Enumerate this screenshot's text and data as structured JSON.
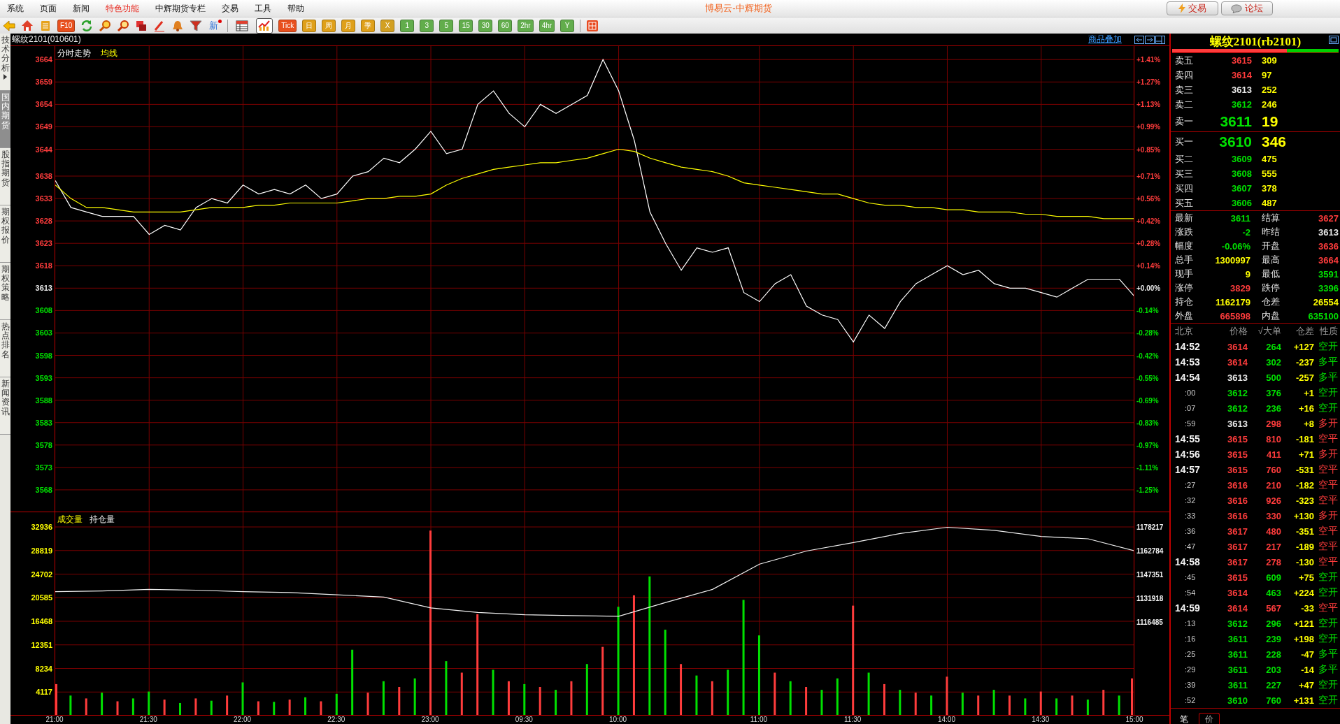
{
  "menu": [
    {
      "label": "系统",
      "highlight": false
    },
    {
      "label": "页面",
      "highlight": false
    },
    {
      "label": "新闻",
      "highlight": false
    },
    {
      "label": "特色功能",
      "highlight": true
    },
    {
      "label": "中辉期货专栏",
      "highlight": false
    },
    {
      "label": "交易",
      "highlight": false
    },
    {
      "label": "工具",
      "highlight": false
    },
    {
      "label": "帮助",
      "highlight": false
    }
  ],
  "window": {
    "title": "博易云-中辉期货"
  },
  "top_buttons": [
    {
      "label": "交易",
      "kind": "trade"
    },
    {
      "label": "论坛",
      "kind": "forum"
    }
  ],
  "toolbar": {
    "f10": "F10",
    "news": "新",
    "views": [
      {
        "selected": false
      },
      {
        "selected": true
      }
    ],
    "periods": [
      {
        "label": "Tick",
        "color": "#e8501e"
      },
      {
        "label": "日",
        "color": "#dfa01a"
      },
      {
        "label": "周",
        "color": "#dfa01a"
      },
      {
        "label": "月",
        "color": "#dfa01a"
      },
      {
        "label": "季",
        "color": "#dfa01a"
      },
      {
        "label": "X",
        "color": "#d2a022"
      },
      {
        "label": "1",
        "color": "#62ad4c"
      },
      {
        "label": "3",
        "color": "#62ad4c"
      },
      {
        "label": "5",
        "color": "#62ad4c"
      },
      {
        "label": "15",
        "color": "#62ad4c"
      },
      {
        "label": "30",
        "color": "#62ad4c"
      },
      {
        "label": "60",
        "color": "#62ad4c"
      },
      {
        "label": "2hr",
        "color": "#62ad4c"
      },
      {
        "label": "4hr",
        "color": "#62ad4c"
      },
      {
        "label": "Y",
        "color": "#62ad4c"
      }
    ]
  },
  "side_tabs": [
    {
      "label": "技术分析",
      "selected": false,
      "has_arrow": true
    },
    {
      "label": "国内期货",
      "selected": true,
      "has_arrow": false
    },
    {
      "label": "股指期货",
      "selected": false,
      "has_arrow": false
    },
    {
      "label": "期权报价",
      "selected": false,
      "has_arrow": false
    },
    {
      "label": "期权策略",
      "selected": false,
      "has_arrow": false
    },
    {
      "label": "热点排名",
      "selected": false,
      "has_arrow": false
    },
    {
      "label": "新闻资讯",
      "selected": false,
      "has_arrow": false
    }
  ],
  "chart_header": {
    "title": "螺纹2101(010601)",
    "overlay_link": "商品叠加"
  },
  "price_chart": {
    "percent_ticks": [
      {
        "label": "+1.41%",
        "color": "#ff3c3c"
      },
      {
        "label": "+1.27%",
        "color": "#ff3c3c"
      },
      {
        "label": "+1.13%",
        "color": "#ff3c3c"
      },
      {
        "label": "+0.99%",
        "color": "#ff3c3c"
      },
      {
        "label": "+0.85%",
        "color": "#ff3c3c"
      },
      {
        "label": "+0.71%",
        "color": "#ff3c3c"
      },
      {
        "label": "+0.56%",
        "color": "#ff3c3c"
      },
      {
        "label": "+0.42%",
        "color": "#ff3c3c"
      },
      {
        "label": "+0.28%",
        "color": "#ff3c3c"
      },
      {
        "label": "+0.14%",
        "color": "#ff3c3c"
      },
      {
        "label": "+0.00%",
        "color": "#e8e8e8"
      },
      {
        "label": "-0.14%",
        "color": "#00e000"
      },
      {
        "label": "-0.28%",
        "color": "#00e000"
      },
      {
        "label": "-0.42%",
        "color": "#00e000"
      },
      {
        "label": "-0.55%",
        "color": "#00e000"
      },
      {
        "label": "-0.69%",
        "color": "#00e000"
      },
      {
        "label": "-0.83%",
        "color": "#00e000"
      },
      {
        "label": "-0.97%",
        "color": "#00e000"
      },
      {
        "label": "-1.11%",
        "color": "#00e000"
      },
      {
        "label": "-1.25%",
        "color": "#00e000"
      }
    ],
    "chart_data": {
      "type": "line",
      "grid": true,
      "categories": [
        null,
        null,
        null,
        null,
        null,
        null,
        null,
        null,
        null,
        null,
        null,
        null,
        null,
        null,
        null,
        null,
        null,
        null,
        null,
        null,
        null,
        null,
        null,
        null,
        null,
        null,
        null,
        null,
        null,
        null,
        null,
        null,
        null,
        null,
        null,
        null,
        null,
        null,
        null,
        null,
        null,
        null,
        null,
        null,
        null,
        null,
        null,
        null,
        null,
        null,
        null,
        null,
        null,
        null,
        null,
        null,
        null,
        null,
        null,
        null,
        null,
        null,
        null,
        null,
        null,
        null,
        null,
        null,
        null,
        null
      ],
      "series": [
        {
          "name": "分时走势",
          "color": "#ffffff",
          "values": [
            3637,
            3631,
            3630,
            3629,
            3629,
            3629,
            3625,
            3627,
            3626,
            3631,
            3633,
            3632,
            3636,
            3634,
            3635,
            3634,
            3636,
            3633,
            3634,
            3638,
            3639,
            3642,
            3641,
            3644,
            3648,
            3643,
            3644,
            3654,
            3657,
            3652,
            3649,
            3654,
            3652,
            3654,
            3656,
            3664,
            3657,
            3646,
            3630,
            3623,
            3617,
            3622,
            3621,
            3622,
            3612,
            3610,
            3614,
            3616,
            3609,
            3607,
            3606,
            3601,
            3607,
            3604,
            3610,
            3614,
            3616,
            3618,
            3616,
            3617,
            3614,
            3613,
            3613,
            3612,
            3611,
            3613,
            3615,
            3615,
            3615,
            3611
          ]
        },
        {
          "name": "均线",
          "color": "#ffff00",
          "values": [
            3636,
            3633,
            3631,
            3631,
            3630.5,
            3630,
            3630,
            3630,
            3630,
            3630.5,
            3631,
            3631,
            3631,
            3631.5,
            3631.5,
            3632,
            3632,
            3632,
            3632,
            3632.5,
            3633,
            3633,
            3633.5,
            3633.5,
            3634,
            3636,
            3637.5,
            3638.5,
            3639.5,
            3640,
            3640.5,
            3641,
            3641,
            3641.5,
            3642,
            3643,
            3644,
            3643.5,
            3642,
            3641,
            3640,
            3639.5,
            3639,
            3638,
            3636.5,
            3636,
            3635.5,
            3635,
            3634.5,
            3634,
            3634,
            3633,
            3632,
            3631.5,
            3631.5,
            3631,
            3631,
            3630.5,
            3630.5,
            3630,
            3630,
            3630,
            3629.5,
            3629.5,
            3629,
            3629,
            3629,
            3628.5,
            3628.5,
            3628.5
          ]
        }
      ],
      "ylim": [
        3563,
        3667
      ],
      "yticks": [
        {
          "value": 3664,
          "label": "3664"
        },
        {
          "value": 3659,
          "label": "3659"
        },
        {
          "value": 3654,
          "label": "3654"
        },
        {
          "value": 3649,
          "label": "3649"
        },
        {
          "value": 3644,
          "label": "3644"
        },
        {
          "value": 3638,
          "label": "3638"
        },
        {
          "value": 3633,
          "label": "3633"
        },
        {
          "value": 3628,
          "label": "3628"
        },
        {
          "value": 3623,
          "label": "3623"
        },
        {
          "value": 3618,
          "label": "3618"
        },
        {
          "value": 3613,
          "label": "3613"
        },
        {
          "value": 3608,
          "label": "3608"
        },
        {
          "value": 3603,
          "label": "3603"
        },
        {
          "value": 3598,
          "label": "3598"
        },
        {
          "value": 3593,
          "label": "3593"
        },
        {
          "value": 3588,
          "label": "3588"
        },
        {
          "value": 3583,
          "label": "3583"
        },
        {
          "value": 3578,
          "label": "3578"
        },
        {
          "value": 3573,
          "label": "3573"
        },
        {
          "value": 3568,
          "label": "3568"
        }
      ]
    }
  },
  "volume_panel": {
    "volume": {
      "chart_data": {
        "type": "bar",
        "title": "成交量",
        "grid": true,
        "categories": [
          "21:00",
          null,
          null,
          null,
          null,
          null,
          "21:30",
          null,
          null,
          null,
          null,
          null,
          "22:00",
          null,
          null,
          null,
          null,
          null,
          "22:30",
          null,
          null,
          null,
          null,
          null,
          "23:00",
          null,
          null,
          null,
          null,
          null,
          "09:30",
          null,
          null,
          null,
          null,
          null,
          "10:00",
          null,
          null,
          null,
          null,
          null,
          null,
          null,
          null,
          "11:00",
          null,
          null,
          null,
          null,
          null,
          "11:30",
          null,
          null,
          null,
          null,
          null,
          "14:00",
          null,
          null,
          null,
          null,
          null,
          "14:30",
          null,
          null,
          null,
          null,
          null,
          "15:00"
        ],
        "series": [
          {
            "color": "#ff3c3c",
            "values": [
              5500,
              null,
              3000,
              null,
              2500,
              null,
              null,
              2800,
              null,
              3000,
              null,
              3500,
              null,
              2500,
              null,
              2800,
              null,
              2500,
              null,
              null,
              4000,
              null,
              5000,
              null,
              32300,
              null,
              7500,
              17700,
              null,
              6000,
              null,
              5000,
              null,
              6000,
              null,
              12000,
              null,
              21000,
              null,
              null,
              9000,
              null,
              6000,
              null,
              null,
              null,
              7500,
              null,
              5000,
              null,
              null,
              19200,
              null,
              5500,
              null,
              4000,
              null,
              6800,
              null,
              3500,
              null,
              3500,
              null,
              4200,
              null,
              3500,
              null,
              4500,
              null,
              6500
            ]
          },
          {
            "color": "#00e000",
            "values": [
              null,
              3500,
              null,
              4000,
              null,
              3000,
              4200,
              null,
              2200,
              null,
              2600,
              null,
              5800,
              null,
              2400,
              null,
              3200,
              null,
              3800,
              11500,
              null,
              6000,
              null,
              6500,
              null,
              9500,
              null,
              null,
              8000,
              null,
              5500,
              null,
              4500,
              null,
              9000,
              null,
              19000,
              null,
              24300,
              15000,
              null,
              7000,
              null,
              8000,
              20200,
              14000,
              null,
              6000,
              null,
              4500,
              6500,
              null,
              7500,
              null,
              4500,
              null,
              3500,
              null,
              4000,
              null,
              4500,
              null,
              3000,
              null,
              3000,
              null,
              2800,
              null,
              3500,
              null
            ]
          }
        ],
        "ylim": [
          0,
          35500
        ],
        "yticks": [
          {
            "value": 32936,
            "label": "32936"
          },
          {
            "value": 28819,
            "label": "28819"
          },
          {
            "value": 24702,
            "label": "24702"
          },
          {
            "value": 20585,
            "label": "20585"
          },
          {
            "value": 16468,
            "label": "16468"
          },
          {
            "value": 12351,
            "label": "12351"
          },
          {
            "value": 8234,
            "label": "8234"
          },
          {
            "value": 4117,
            "label": "4117"
          }
        ]
      }
    },
    "open_interest": {
      "chart_data": {
        "type": "line",
        "categories": [
          null,
          null,
          null,
          null,
          null,
          null,
          null,
          null,
          null,
          null,
          null,
          null,
          null,
          null,
          null,
          null,
          null,
          null,
          null,
          null,
          null,
          null,
          null,
          null
        ],
        "series": [
          {
            "name": "持仓量",
            "color": "#f0f0f0",
            "values": [
              1136000,
              1136500,
              1137500,
              1137000,
              1136000,
              1135500,
              1134000,
              1132500,
              1125500,
              1122500,
              1121000,
              1120500,
              1120000,
              1129000,
              1137500,
              1154000,
              1162500,
              1168000,
              1174000,
              1178000,
              1176000,
              1172000,
              1170500,
              1162500
            ]
          }
        ],
        "ylim": [
          1116485,
          1178217
        ],
        "yticks": [
          {
            "value": 1178217,
            "label": "1178217"
          },
          {
            "value": 1162784,
            "label": "1162784"
          },
          {
            "value": 1147351,
            "label": "1147351"
          },
          {
            "value": 1131918,
            "label": "1131918"
          },
          {
            "value": 1116485,
            "label": "1116485"
          }
        ]
      }
    }
  },
  "quote_panel": {
    "title": "螺纹2101(rb2101)",
    "strength_bar": {
      "level": 0.69
    },
    "asks": [
      {
        "label": "卖五",
        "price": "3615",
        "volume": "309",
        "color": "#ff3c3c",
        "kind": "level"
      },
      {
        "label": "卖四",
        "price": "3614",
        "volume": "97",
        "color": "#ff3c3c",
        "kind": "level"
      },
      {
        "label": "卖三",
        "price": "3613",
        "volume": "252",
        "color": "#e8e8e8",
        "kind": "level"
      },
      {
        "label": "卖二",
        "price": "3612",
        "volume": "246",
        "color": "#00e000",
        "kind": "level"
      },
      {
        "label": "卖一",
        "price": "3611",
        "volume": "19",
        "color": "#00e000",
        "kind": "best"
      }
    ],
    "bids": [
      {
        "label": "买一",
        "price": "3610",
        "volume": "346",
        "color": "#00e000",
        "kind": "best"
      },
      {
        "label": "买二",
        "price": "3609",
        "volume": "475",
        "color": "#00e000",
        "kind": "level"
      },
      {
        "label": "买三",
        "price": "3608",
        "volume": "555",
        "color": "#00e000",
        "kind": "level"
      },
      {
        "label": "买四",
        "price": "3607",
        "volume": "378",
        "color": "#00e000",
        "kind": "level"
      },
      {
        "label": "买五",
        "price": "3606",
        "volume": "487",
        "color": "#00e000",
        "kind": "level"
      }
    ],
    "stats": [
      {
        "label": "最新",
        "value": "3611",
        "color": "#00e000"
      },
      {
        "label": "结算",
        "value": "3627",
        "color": "#ff3c3c"
      },
      {
        "label": "涨跌",
        "value": "-2",
        "color": "#00e000"
      },
      {
        "label": "昨结",
        "value": "3613",
        "color": "#e8e8e8"
      },
      {
        "label": "幅度",
        "value": "-0.06%",
        "color": "#00e000"
      },
      {
        "label": "开盘",
        "value": "3636",
        "color": "#ff3c3c"
      },
      {
        "label": "总手",
        "value": "1300997",
        "color": "#ffff00"
      },
      {
        "label": "最高",
        "value": "3664",
        "color": "#ff3c3c"
      },
      {
        "label": "现手",
        "value": "9",
        "color": "#ffff00"
      },
      {
        "label": "最低",
        "value": "3591",
        "color": "#00e000"
      },
      {
        "label": "涨停",
        "value": "3829",
        "color": "#ff3c3c"
      },
      {
        "label": "跌停",
        "value": "3396",
        "color": "#00e000"
      },
      {
        "label": "持仓",
        "value": "1162179",
        "color": "#ffff00"
      },
      {
        "label": "仓差",
        "value": "26554",
        "color": "#ffff00"
      },
      {
        "label": "外盘",
        "value": "665898",
        "color": "#ff3c3c"
      },
      {
        "label": "内盘",
        "value": "635100",
        "color": "#00e000"
      }
    ],
    "trade_columns": [
      "北京",
      "价格",
      "√大单",
      "仓差",
      "性质"
    ],
    "trades": [
      {
        "time": "14:52",
        "kind": "minute",
        "price": {
          "text": "3614",
          "color": "#ff3c3c"
        },
        "volume": "264",
        "diff": "+127",
        "nature": "空开",
        "color": "#00e000"
      },
      {
        "time": "14:53",
        "kind": "minute",
        "price": {
          "text": "3614",
          "color": "#ff3c3c"
        },
        "volume": "302",
        "diff": "-237",
        "nature": "多平",
        "color": "#00e000"
      },
      {
        "time": "14:54",
        "kind": "minute",
        "price": {
          "text": "3613",
          "color": "#e8e8e8"
        },
        "volume": "500",
        "diff": "-257",
        "nature": "多平",
        "color": "#00e000"
      },
      {
        "time": ":00",
        "kind": "second",
        "price": {
          "text": "3612",
          "color": "#00e000"
        },
        "volume": "376",
        "diff": "+1",
        "nature": "空开",
        "color": "#00e000"
      },
      {
        "time": ":07",
        "kind": "second",
        "price": {
          "text": "3612",
          "color": "#00e000"
        },
        "volume": "236",
        "diff": "+16",
        "nature": "空开",
        "color": "#00e000"
      },
      {
        "time": ":59",
        "kind": "second",
        "price": {
          "text": "3613",
          "color": "#e8e8e8"
        },
        "volume": "298",
        "diff": "+8",
        "nature": "多开",
        "color": "#ff3c3c"
      },
      {
        "time": "14:55",
        "kind": "minute",
        "price": {
          "text": "3615",
          "color": "#ff3c3c"
        },
        "volume": "810",
        "diff": "-181",
        "nature": "空平",
        "color": "#ff3c3c"
      },
      {
        "time": "14:56",
        "kind": "minute",
        "price": {
          "text": "3615",
          "color": "#ff3c3c"
        },
        "volume": "411",
        "diff": "+71",
        "nature": "多开",
        "color": "#ff3c3c"
      },
      {
        "time": "14:57",
        "kind": "minute",
        "price": {
          "text": "3615",
          "color": "#ff3c3c"
        },
        "volume": "760",
        "diff": "-531",
        "nature": "空平",
        "color": "#ff3c3c"
      },
      {
        "time": ":27",
        "kind": "second",
        "price": {
          "text": "3616",
          "color": "#ff3c3c"
        },
        "volume": "210",
        "diff": "-182",
        "nature": "空平",
        "color": "#ff3c3c"
      },
      {
        "time": ":32",
        "kind": "second",
        "price": {
          "text": "3616",
          "color": "#ff3c3c"
        },
        "volume": "926",
        "diff": "-323",
        "nature": "空平",
        "color": "#ff3c3c"
      },
      {
        "time": ":33",
        "kind": "second",
        "price": {
          "text": "3616",
          "color": "#ff3c3c"
        },
        "volume": "330",
        "diff": "+130",
        "nature": "多开",
        "color": "#ff3c3c"
      },
      {
        "time": ":36",
        "kind": "second",
        "price": {
          "text": "3617",
          "color": "#ff3c3c"
        },
        "volume": "480",
        "diff": "-351",
        "nature": "空平",
        "color": "#ff3c3c"
      },
      {
        "time": ":47",
        "kind": "second",
        "price": {
          "text": "3617",
          "color": "#ff3c3c"
        },
        "volume": "217",
        "diff": "-189",
        "nature": "空平",
        "color": "#ff3c3c"
      },
      {
        "time": "14:58",
        "kind": "minute",
        "price": {
          "text": "3617",
          "color": "#ff3c3c"
        },
        "volume": "278",
        "diff": "-130",
        "nature": "空平",
        "color": "#ff3c3c"
      },
      {
        "time": ":45",
        "kind": "second",
        "price": {
          "text": "3615",
          "color": "#ff3c3c"
        },
        "volume": "609",
        "diff": "+75",
        "nature": "空开",
        "color": "#00e000"
      },
      {
        "time": ":54",
        "kind": "second",
        "price": {
          "text": "3614",
          "color": "#ff3c3c"
        },
        "volume": "463",
        "diff": "+224",
        "nature": "空开",
        "color": "#00e000"
      },
      {
        "time": "14:59",
        "kind": "minute",
        "price": {
          "text": "3614",
          "color": "#ff3c3c"
        },
        "volume": "567",
        "diff": "-33",
        "nature": "空平",
        "color": "#ff3c3c"
      },
      {
        "time": ":13",
        "kind": "second",
        "price": {
          "text": "3612",
          "color": "#00e000"
        },
        "volume": "296",
        "diff": "+121",
        "nature": "空开",
        "color": "#00e000"
      },
      {
        "time": ":16",
        "kind": "second",
        "price": {
          "text": "3611",
          "color": "#00e000"
        },
        "volume": "239",
        "diff": "+198",
        "nature": "空开",
        "color": "#00e000"
      },
      {
        "time": ":25",
        "kind": "second",
        "price": {
          "text": "3611",
          "color": "#00e000"
        },
        "volume": "228",
        "diff": "-47",
        "nature": "多平",
        "color": "#00e000"
      },
      {
        "time": ":29",
        "kind": "second",
        "price": {
          "text": "3611",
          "color": "#00e000"
        },
        "volume": "203",
        "diff": "-14",
        "nature": "多平",
        "color": "#00e000"
      },
      {
        "time": ":39",
        "kind": "second",
        "price": {
          "text": "3611",
          "color": "#00e000"
        },
        "volume": "227",
        "diff": "+47",
        "nature": "空开",
        "color": "#00e000"
      },
      {
        "time": ":52",
        "kind": "second",
        "price": {
          "text": "3610",
          "color": "#00e000"
        },
        "volume": "760",
        "diff": "+131",
        "nature": "空开",
        "color": "#00e000"
      }
    ],
    "bottom_tabs": [
      {
        "label": "笔",
        "selected": true
      },
      {
        "label": "价",
        "selected": false
      }
    ]
  }
}
